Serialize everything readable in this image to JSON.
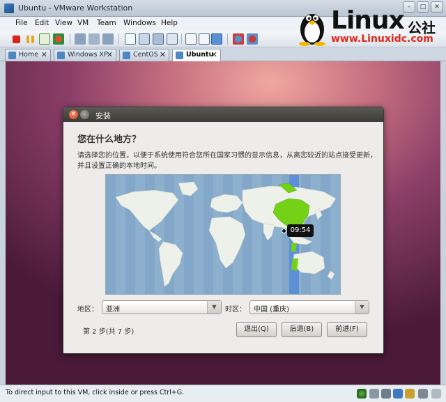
{
  "window": {
    "title": "Ubuntu - VMware Workstation",
    "controls": {
      "minimize": "–",
      "maximize": "□",
      "close": "✕"
    }
  },
  "logo": {
    "brand": "Linux",
    "brand_cn": "公社",
    "url": "www.Linuxidc.com"
  },
  "menu": [
    "File",
    "Edit",
    "View",
    "VM",
    "Team",
    "Windows",
    "Help"
  ],
  "tabs": [
    {
      "label": "Home",
      "close": "✕",
      "active": false
    },
    {
      "label": "Windows XP",
      "close": "✕",
      "active": false
    },
    {
      "label": "CentOS",
      "close": "✕",
      "active": false
    },
    {
      "label": "Ubuntu",
      "close": "✕",
      "active": true
    }
  ],
  "dialog": {
    "title": "安装",
    "heading": "您在什么地方？",
    "description": "请选择您的位置，以便于系统使用符合您所在国家习惯的显示信息，从离您较近的站点接受更新，并且设置正确的本地时间。",
    "map_time": "09:54",
    "region_label": "地区：",
    "region_value": "亚洲",
    "timezone_label": "时区：",
    "timezone_value": "中国 (重庆)",
    "step_text": "第 2 步(共 7 步)",
    "quit_button": "退出(Q)",
    "back_button": "后退(B)",
    "forward_button": "前进(F)",
    "close_glyph": "✕",
    "min_glyph": "–",
    "arrow_glyph": "▼"
  },
  "statusbar": {
    "text": "To direct input to this VM, click inside or press Ctrl+G."
  },
  "colors": {
    "map_ocean": "#8db0cf",
    "map_land": "#eef0ea",
    "map_selected": "#73d216",
    "timezone_band": "#5c8fd6"
  }
}
